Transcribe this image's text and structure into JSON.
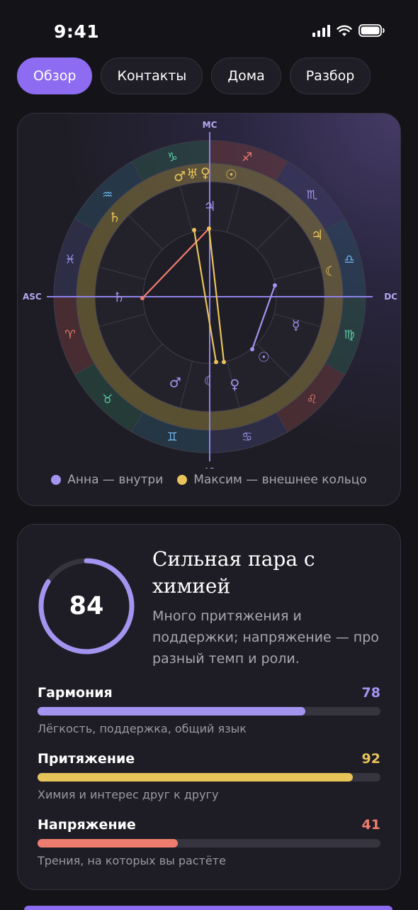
{
  "status_bar": {
    "time": "9:41"
  },
  "tabs": [
    {
      "label": "Обзор",
      "active": true
    },
    {
      "label": "Контакты",
      "active": false
    },
    {
      "label": "Дома",
      "active": false
    },
    {
      "label": "Разбор",
      "active": false
    }
  ],
  "chart": {
    "axes": {
      "top": "MC",
      "bottom": "IC",
      "left": "ASC",
      "right": "DC"
    },
    "zodiac_icons": [
      "aries-icon",
      "taurus-icon",
      "gemini-icon",
      "cancer-icon",
      "leo-icon",
      "virgo-icon",
      "libra-icon",
      "scorpio-icon",
      "sagittarius-icon",
      "capricorn-icon",
      "aquarius-icon",
      "pisces-icon"
    ],
    "legend": [
      {
        "label": "Анна — внутри",
        "color": "#a394f0"
      },
      {
        "label": "Максим — внешнее кольцо",
        "color": "#e8c35a"
      }
    ]
  },
  "compatibility": {
    "score": "84",
    "score_value": 84,
    "title": "Сильная пара с химией",
    "description": "Много притяжения и поддержки; напряжение — про разный темп и роли.",
    "metrics": [
      {
        "label": "Гармония",
        "value": "78",
        "fill": 78,
        "sub": "Лёгкость, поддержка, общий язык",
        "color": "#a394f0"
      },
      {
        "label": "Притяжение",
        "value": "92",
        "fill": 92,
        "sub": "Химия и интерес друг к другу",
        "color": "#e8c35a"
      },
      {
        "label": "Напряжение",
        "value": "41",
        "fill": 41,
        "sub": "Трения, на которых вы растёте",
        "color": "#ee7d6f"
      }
    ]
  },
  "colors": {
    "accent": "#8e6cf2",
    "anna": "#a394f0",
    "maxim": "#e8c35a",
    "tension": "#ee7d6f"
  }
}
